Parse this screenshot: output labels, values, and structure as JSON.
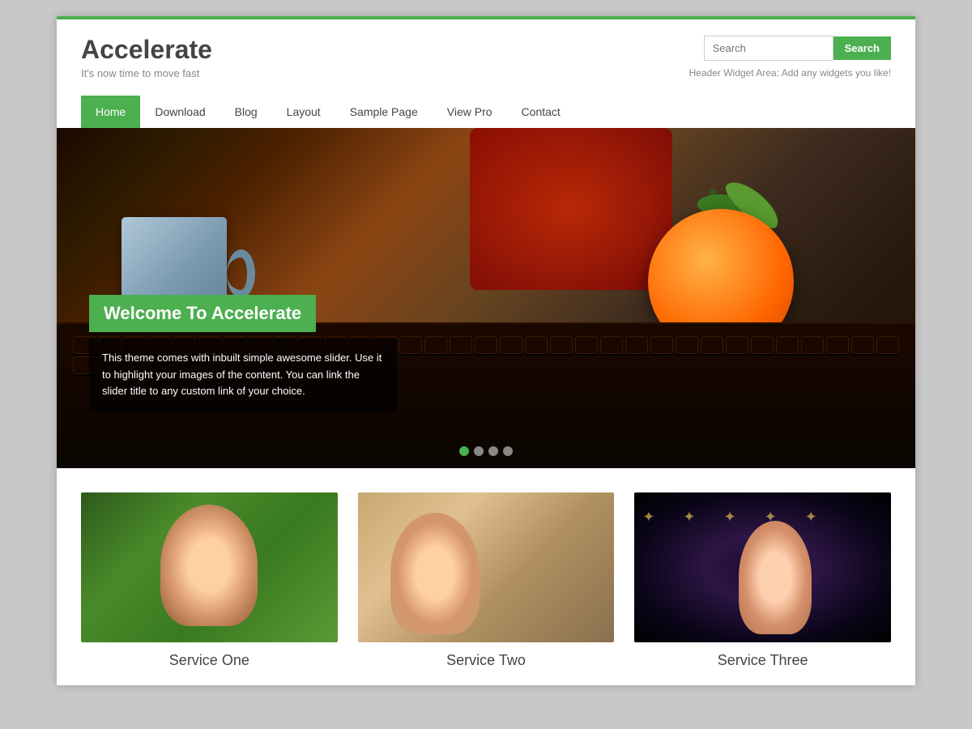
{
  "site": {
    "title": "Accelerate",
    "tagline": "It's now time to move fast",
    "top_bar_color": "#4caf50"
  },
  "header": {
    "search_placeholder": "Search",
    "search_button_label": "Search",
    "widget_text": "Header Widget Area: Add any widgets you like!"
  },
  "nav": {
    "items": [
      {
        "label": "Home",
        "active": true
      },
      {
        "label": "Download",
        "active": false
      },
      {
        "label": "Blog",
        "active": false
      },
      {
        "label": "Layout",
        "active": false
      },
      {
        "label": "Sample Page",
        "active": false
      },
      {
        "label": "View Pro",
        "active": false
      },
      {
        "label": "Contact",
        "active": false
      }
    ]
  },
  "slider": {
    "title": "Welcome To Accelerate",
    "description": "This theme comes with inbuilt simple awesome slider. Use it to highlight your images of the content. You can link the slider title to any custom link of your choice.",
    "dots": [
      {
        "active": true
      },
      {
        "active": false
      },
      {
        "active": false
      },
      {
        "active": false
      }
    ]
  },
  "services": {
    "items": [
      {
        "title": "Service One"
      },
      {
        "title": "Service Two"
      },
      {
        "title": "Service Three"
      }
    ]
  },
  "colors": {
    "accent": "#4caf50",
    "text_dark": "#444444",
    "text_light": "#888888"
  }
}
